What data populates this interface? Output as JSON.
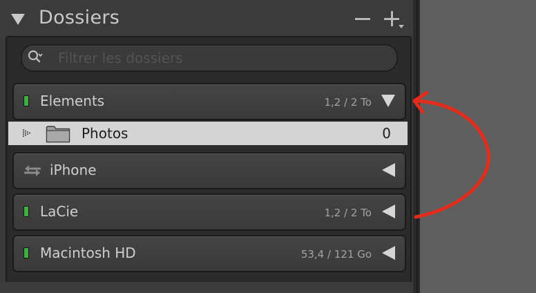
{
  "panel": {
    "title": "Dossiers"
  },
  "search": {
    "placeholder": "Filtrer les dossiers",
    "value": ""
  },
  "volumes": [
    {
      "name": "Elements",
      "capacity": "1,2 / 2 To",
      "state": "expanded",
      "status_color": "#3cb142"
    },
    {
      "name": "iPhone",
      "capacity": "",
      "state": "collapsed",
      "type": "synced-device"
    },
    {
      "name": "LaCie",
      "capacity": "1,2 / 2 To",
      "state": "collapsed",
      "status_color": "#3cb142"
    },
    {
      "name": "Macintosh HD",
      "capacity": "53,4 / 121 Go",
      "state": "collapsed",
      "status_color": "#3cb142"
    }
  ],
  "folder": {
    "name": "Photos",
    "count": "0",
    "selected": true
  },
  "colors": {
    "annotation": "#e22c1c",
    "selection_bg": "#d4d4d4",
    "panel_bg": "#3a3a3a"
  },
  "icons": {
    "collapse": "triangle-down-icon",
    "remove": "minus-icon",
    "add": "plus-icon",
    "search": "search-icon",
    "expand": "triangle-down-icon",
    "collapsed": "triangle-left-icon",
    "sync": "sync-arrows-icon",
    "folder": "folder-icon"
  }
}
